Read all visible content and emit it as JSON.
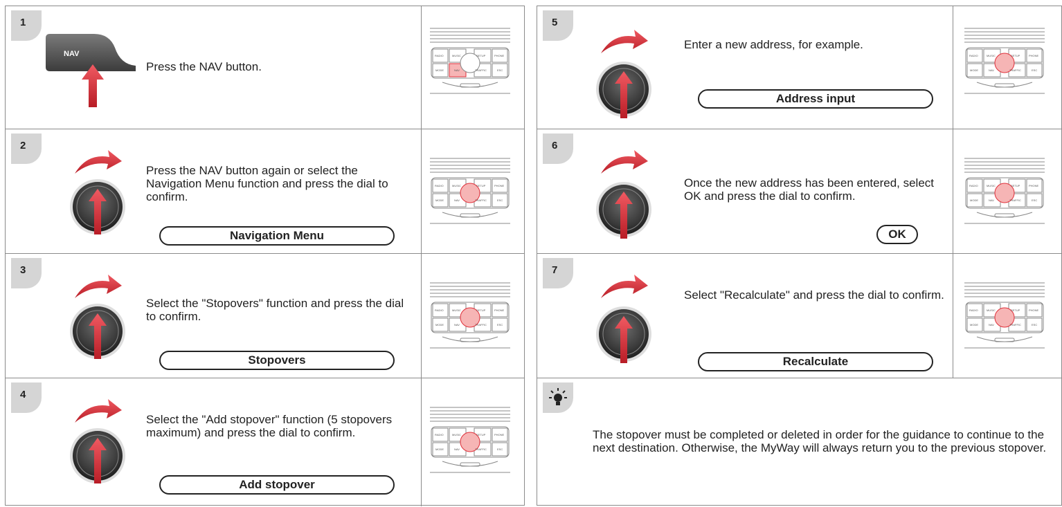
{
  "steps": [
    {
      "number": "1",
      "text": "Press the NAV button.",
      "button_label": "NAV",
      "pill": ""
    },
    {
      "number": "2",
      "text": "Press the NAV button again or select the Navigation Menu function and press the dial to confirm.",
      "pill": "Navigation Menu"
    },
    {
      "number": "3",
      "text": "Select the \"Stopovers\" function and press the dial to confirm.",
      "pill": "Stopovers"
    },
    {
      "number": "4",
      "text": "Select the \"Add stopover\" function (5 stopovers maximum) and press the dial to confirm.",
      "pill": "Add stopover"
    },
    {
      "number": "5",
      "text": "Enter a new address, for example.",
      "pill": "Address input"
    },
    {
      "number": "6",
      "text": "Once the new address has been entered, select OK and press the dial to confirm.",
      "pill": "OK"
    },
    {
      "number": "7",
      "text": "Select \"Recalculate\" and press the dial to confirm.",
      "pill": "Recalculate"
    }
  ],
  "tip": {
    "text": "The stopover must be completed or deleted in order for the guidance to continue to the next destination. Otherwise, the MyWay will always return you to the previous stopover."
  },
  "console_buttons": [
    "RADIO",
    "MUSIC",
    "SETUP",
    "PHONE",
    "MODE",
    "NAV",
    "TRAFFIC",
    "ESC"
  ],
  "colors": {
    "accent": "#e0303a",
    "highlight": "#f6b5b5",
    "border": "#8a8a8a",
    "badge": "#d5d5d5"
  }
}
